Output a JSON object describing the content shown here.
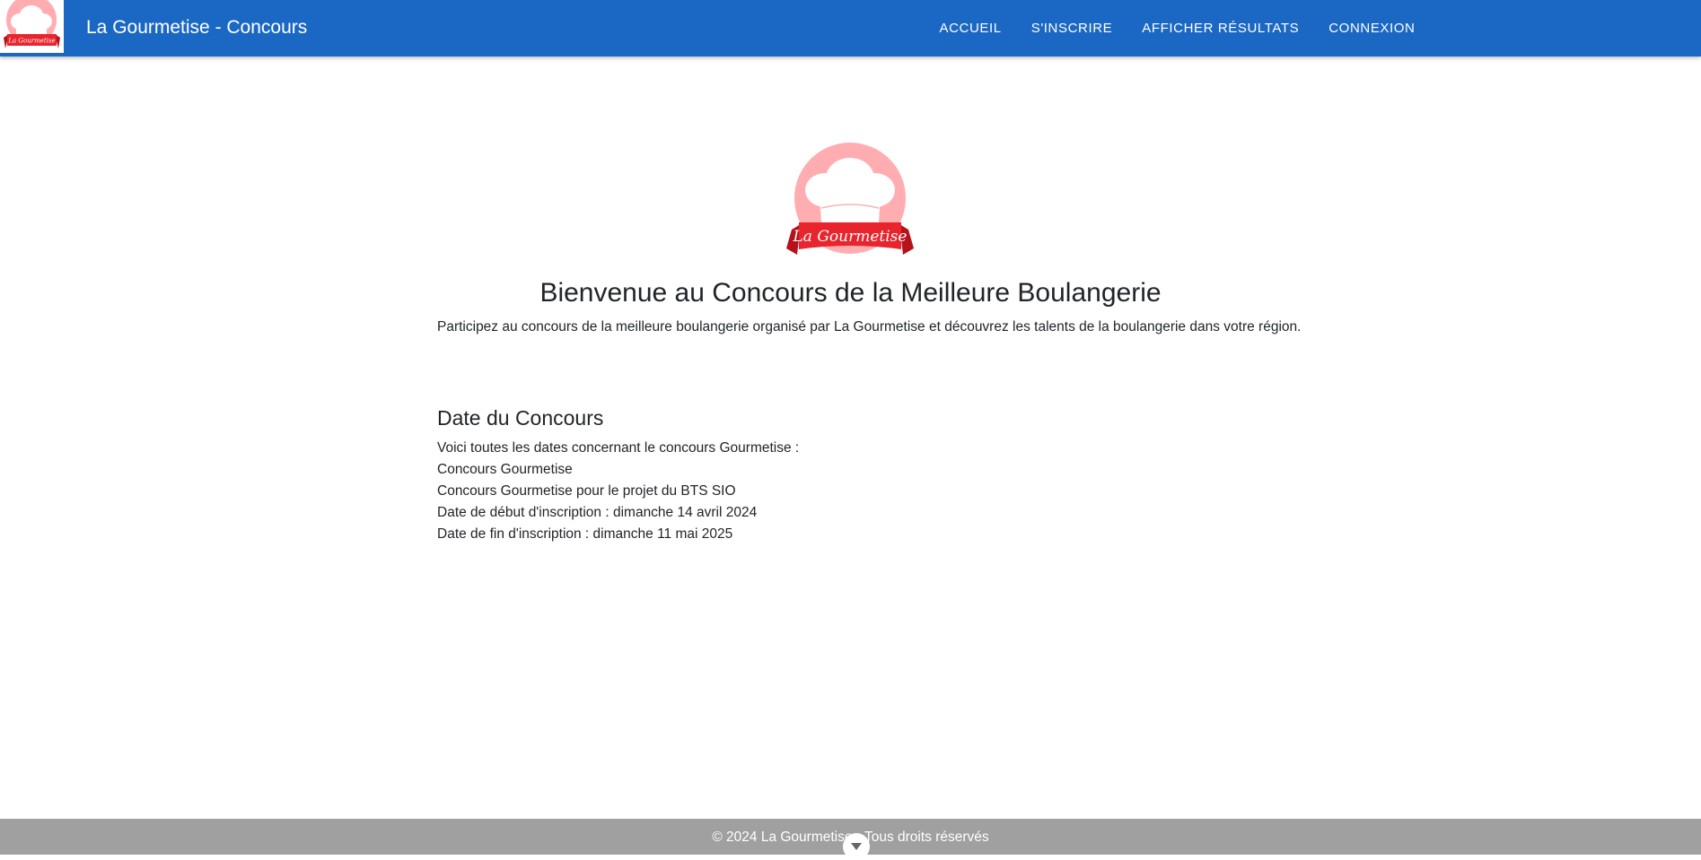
{
  "header": {
    "brand": "La Gourmetise - Concours",
    "logo_text": "La Gourmetise",
    "nav": [
      {
        "label": "Accueil"
      },
      {
        "label": "S'inscrire"
      },
      {
        "label": "Afficher résultats"
      },
      {
        "label": "Connexion"
      }
    ]
  },
  "main": {
    "logo_text": "La Gourmetise",
    "title": "Bienvenue au Concours de la Meilleure Boulangerie",
    "intro": "Participez au concours de la meilleure boulangerie organisé par La Gourmetise et découvrez les talents de la boulangerie dans votre région.",
    "section": {
      "title": "Date du Concours",
      "lines": [
        "Voici toutes les dates concernant le concours Gourmetise :",
        "Concours Gourmetise",
        "Concours Gourmetise pour le projet du BTS SIO",
        "Date de début d'inscription : dimanche 14 avril 2024",
        "Date de fin d'inscription : dimanche 11 mai 2025"
      ]
    }
  },
  "footer": {
    "text": "© 2024 La Gourmetise - Tous droits réservés"
  },
  "colors": {
    "navbar": "#1a68c4",
    "footer": "#a0a0a0",
    "logo_circle": "#ffadb0",
    "logo_ribbon": "#e8242d"
  },
  "icons": {
    "logo": "chef-hat-logo",
    "scroll": "chevron-down-icon"
  }
}
